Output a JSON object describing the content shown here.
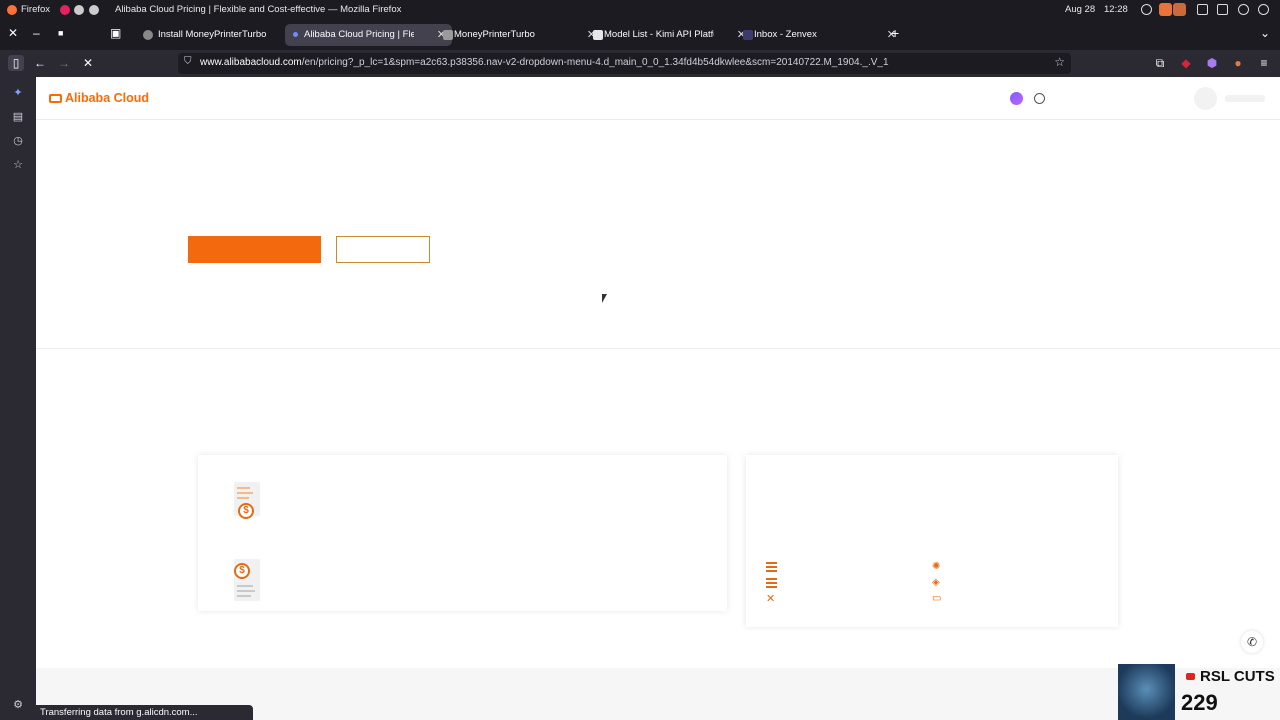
{
  "os": {
    "app_name": "Firefox",
    "window_title": "Alibaba Cloud Pricing | Flexible and Cost-effective — Mozilla Firefox",
    "date": "Aug 28",
    "time": "12:28"
  },
  "tabs": [
    {
      "label": "Install MoneyPrinterTurbo"
    },
    {
      "label": "Alibaba Cloud Pricing | Flexible"
    },
    {
      "label": "MoneyPrinterTurbo"
    },
    {
      "label": "Model List - Kimi API Platform"
    },
    {
      "label": "Inbox - Zenvex"
    }
  ],
  "address": {
    "host": "www.alibabacloud.com",
    "path": "/en/pricing?_p_lc=1&spm=a2c63.p38356.nav-v2-dropdown-menu-4.d_main_0_0_1.34fd4b54dkwlee&scm=20140722.M_1904._.V_1"
  },
  "site": {
    "logo_text": "Alibaba Cloud",
    "brand_color": "#ff6a00"
  },
  "status_bar": {
    "text": "Transferring data from g.alicdn.com..."
  },
  "overlay": {
    "channel": "RSL CUTS",
    "count": "229"
  },
  "icons": [
    "close-icon",
    "minimize-icon",
    "maximize-icon",
    "back-icon",
    "forward-icon",
    "reload-icon",
    "lock-icon",
    "bookmark-star-icon",
    "extensions-icon",
    "menu-icon",
    "phone-icon",
    "server-icon",
    "settings-icon"
  ]
}
